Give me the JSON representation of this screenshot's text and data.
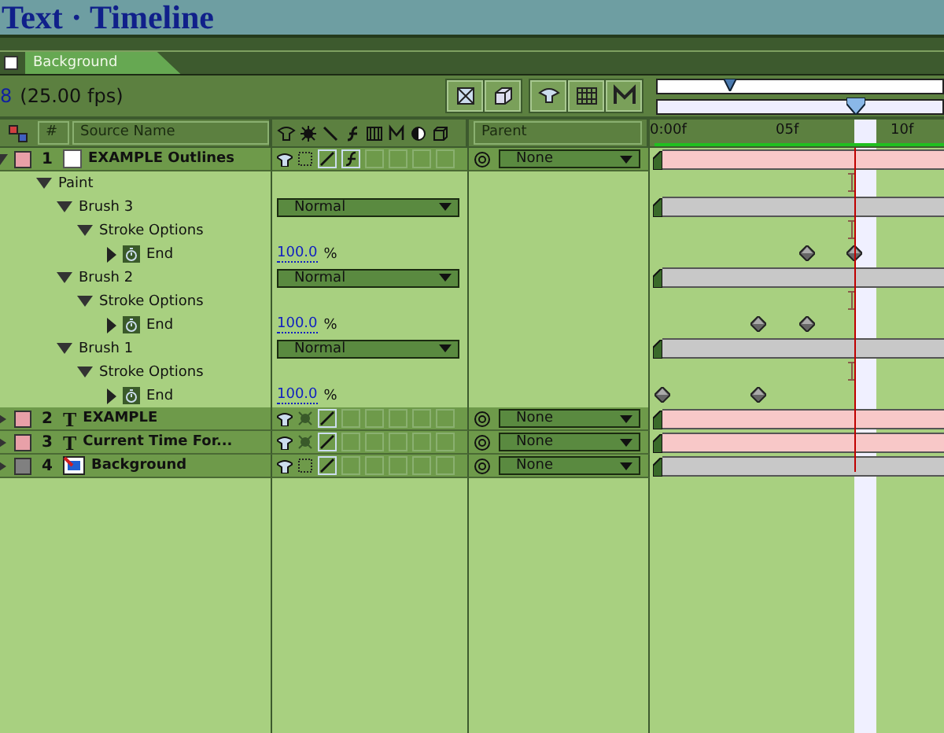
{
  "window": {
    "title": "Text · Timeline"
  },
  "tabs": [
    {
      "label": "Background",
      "selected": true
    }
  ],
  "info": {
    "timecode": "8",
    "fps": "(25.00 fps)"
  },
  "columns": {
    "source_name": "Source Name",
    "number": "#",
    "parent": "Parent"
  },
  "ruler": {
    "ticks": [
      "0:00f",
      "05f",
      "10f"
    ],
    "current_time": {
      "level": 0.695
    },
    "nav_marker": {
      "level": 0.23
    }
  },
  "layers": [
    {
      "number": "1",
      "name": "EXAMPLE Outlines",
      "color": "#e8a0a8",
      "kind": "solid",
      "expanded": true,
      "effects": true,
      "parent": "None",
      "children": [
        {
          "name": "Paint",
          "kind": "group",
          "expanded": true,
          "children": [
            {
              "name": "Brush 3",
              "kind": "brush",
              "expanded": true,
              "mode": "Normal",
              "children": [
                {
                  "name": "Stroke Options",
                  "kind": "group",
                  "expanded": true,
                  "children": [
                    {
                      "name": "End",
                      "kind": "property",
                      "value": "100.0",
                      "unit": "%",
                      "keyframes": [
                        {
                          "level": 0.535
                        },
                        {
                          "level": 0.695
                        }
                      ]
                    }
                  ]
                }
              ]
            },
            {
              "name": "Brush 2",
              "kind": "brush",
              "expanded": true,
              "mode": "Normal",
              "children": [
                {
                  "name": "Stroke Options",
                  "kind": "group",
                  "expanded": true,
                  "children": [
                    {
                      "name": "End",
                      "kind": "property",
                      "value": "100.0",
                      "unit": "%",
                      "keyframes": [
                        {
                          "level": 0.369
                        },
                        {
                          "level": 0.535
                        }
                      ]
                    }
                  ]
                }
              ]
            },
            {
              "name": "Brush 1",
              "kind": "brush",
              "expanded": true,
              "mode": "Normal",
              "children": [
                {
                  "name": "Stroke Options",
                  "kind": "group",
                  "expanded": true,
                  "children": [
                    {
                      "name": "End",
                      "kind": "property",
                      "value": "100.0",
                      "unit": "%",
                      "keyframes": [
                        {
                          "level": 0.043
                        },
                        {
                          "level": 0.369
                        }
                      ]
                    }
                  ]
                }
              ]
            }
          ]
        }
      ]
    },
    {
      "number": "2",
      "name": "EXAMPLE",
      "color": "#e8a0a8",
      "kind": "text",
      "glyph": "T",
      "expanded": false,
      "effects": false,
      "parent": "None"
    },
    {
      "number": "3",
      "name": "Current Time For...",
      "color": "#e8a0a8",
      "kind": "text",
      "glyph": "T",
      "expanded": false,
      "effects": false,
      "parent": "None"
    },
    {
      "number": "4",
      "name": "Background",
      "color": "#808080",
      "kind": "footage",
      "expanded": false,
      "effects": false,
      "parent": "None"
    }
  ]
}
